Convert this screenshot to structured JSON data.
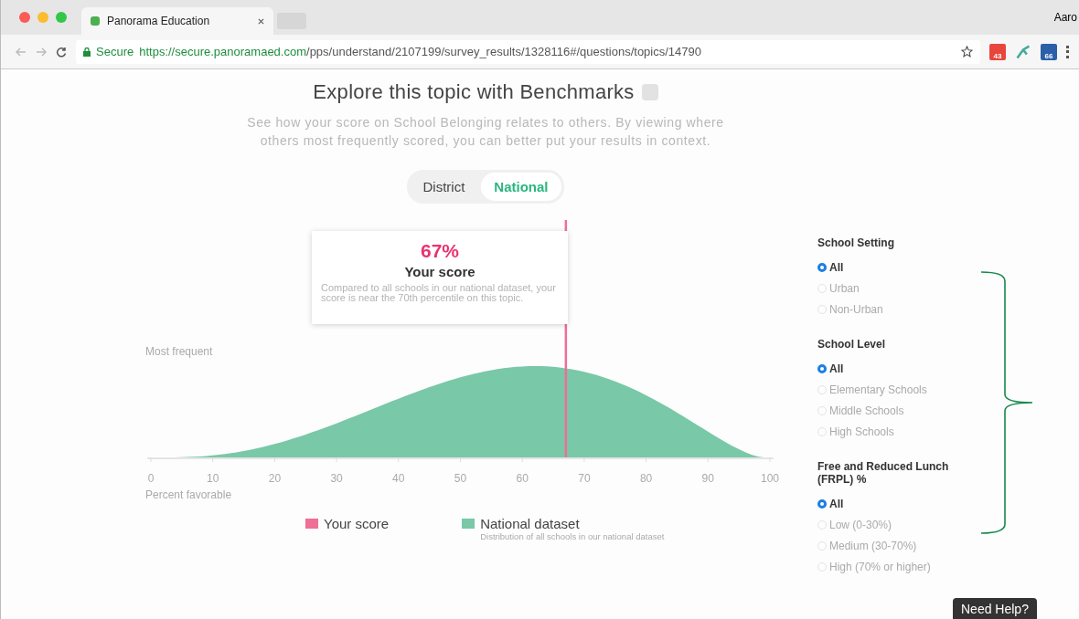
{
  "browser": {
    "tabs": [
      {
        "title": "Panorama Education"
      }
    ],
    "profile": "Aaro",
    "secure_label": "Secure",
    "url_host": "https://secure.panoramaed.com",
    "url_path": "/pps/understand/2107199/survey_results/1328116#/questions/topics/14790",
    "extensions": [
      {
        "kind": "calendar",
        "badge": "43"
      },
      {
        "kind": "puzzle"
      },
      {
        "kind": "house",
        "badge": "66"
      }
    ]
  },
  "header": {
    "title": "Explore this topic with Benchmarks",
    "description": "See how your score on School Belonging relates to others. By viewing where others most frequently scored, you can better put your results in context."
  },
  "toggle": [
    {
      "label": "District",
      "selected": false
    },
    {
      "label": "National",
      "selected": true
    }
  ],
  "tooltip": {
    "value": "67%",
    "title": "Your score",
    "text": "Compared to all schools in our national dataset, your score is near the 70th percentile on this topic."
  },
  "chart": {
    "y_label": "Most frequent",
    "x_label": "Percent favorable",
    "x_ticks": [
      "0",
      "10",
      "20",
      "30",
      "40",
      "50",
      "60",
      "70",
      "80",
      "90",
      "100"
    ],
    "score_marker": {
      "level": 0.67
    }
  },
  "legend": [
    {
      "label": "Your score",
      "color": "#ef6f96"
    },
    {
      "label": "National dataset",
      "color": "#79c8a8",
      "note": "Distribution of all schools in our national dataset"
    }
  ],
  "filters": [
    {
      "title": "School Setting",
      "options": [
        {
          "label": "All",
          "selected": true
        },
        {
          "label": "Urban",
          "selected": false
        },
        {
          "label": "Non-Urban",
          "selected": false
        }
      ]
    },
    {
      "title": "School Level",
      "options": [
        {
          "label": "All",
          "selected": true
        },
        {
          "label": "Elementary Schools",
          "selected": false
        },
        {
          "label": "Middle Schools",
          "selected": false
        },
        {
          "label": "High Schools",
          "selected": false
        }
      ]
    },
    {
      "title": "Free and Reduced Lunch (FRPL) %",
      "options": [
        {
          "label": "All",
          "selected": true
        },
        {
          "label": "Low (0-30%)",
          "selected": false
        },
        {
          "label": "Medium (30-70%)",
          "selected": false
        },
        {
          "label": "High (70% or higher)",
          "selected": false
        }
      ]
    }
  ],
  "help_button": "Need Help?"
}
